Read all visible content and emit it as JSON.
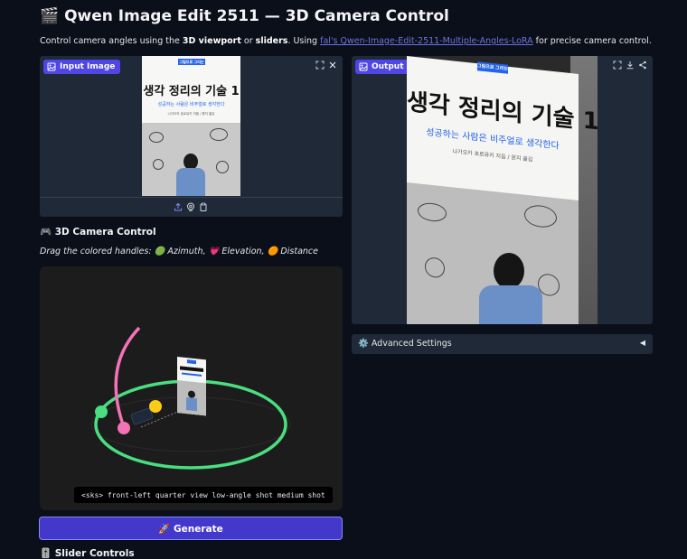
{
  "header": {
    "title": "🎬 Qwen Image Edit 2511 — 3D Camera Control",
    "desc_prefix": "Control camera angles using the ",
    "desc_b1": "3D viewport",
    "desc_mid": " or ",
    "desc_b2": "sliders",
    "desc_mid2": ". Using ",
    "desc_link": "fal's Qwen-Image-Edit-2511-Multiple-Angles-LoRA",
    "desc_suffix": " for precise camera control."
  },
  "input_panel": {
    "label": "Input Image",
    "icons": [
      "fullscreen-icon",
      "close-icon",
      "upload-icon",
      "webcam-icon",
      "clipboard-icon"
    ]
  },
  "output_panel": {
    "label": "Output Image",
    "icons": [
      "fullscreen-icon",
      "download-icon",
      "share-icon"
    ]
  },
  "book": {
    "tag": "그림으로 그리는",
    "title": "생각 정리의 기술 1",
    "subtitle": "성공하는 사람은 비주얼로 생각한다",
    "author": "나가오카 호로유키 지음 / 원지 옮김"
  },
  "camera_control": {
    "heading": "🎮 3D Camera Control",
    "hint": "Drag the colored handles: 🟢 Azimuth, 💗 Elevation, 🟠 Distance",
    "prompt": "<sks> front-left quarter view low-angle shot medium shot"
  },
  "generate": {
    "label": "🚀 Generate"
  },
  "slider_section": {
    "heading": "🎚️ Slider Controls"
  },
  "advanced": {
    "label": "⚙️ Advanced Settings",
    "arrow": "◀"
  },
  "colors": {
    "accent": "#4f46e5",
    "azimuth": "#4ade80",
    "elevation": "#f472b6",
    "distance": "#facc15",
    "panel": "#1f2937",
    "background": "#0b0f19"
  }
}
